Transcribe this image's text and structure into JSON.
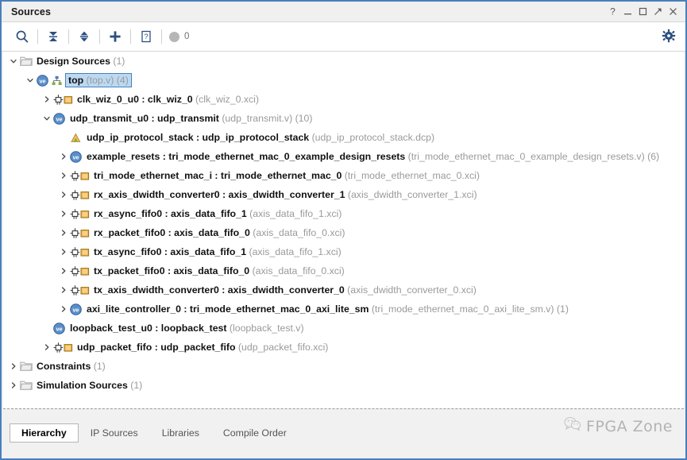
{
  "window": {
    "title": "Sources",
    "buttons": [
      {
        "name": "help-button",
        "glyph": "?"
      },
      {
        "name": "minimize-button",
        "glyph": "_"
      },
      {
        "name": "maximize-button",
        "glyph": "□"
      },
      {
        "name": "float-button",
        "glyph": "↗"
      },
      {
        "name": "close-button",
        "glyph": "✕"
      }
    ]
  },
  "toolbar": {
    "search_label": "search-icon",
    "collapse_all_label": "collapse-all-icon",
    "expand_all_label": "expand-collapse-icon",
    "add_sources_label": "add-sources-icon",
    "help_label": "help-file-icon",
    "count": "0",
    "settings_label": "settings-gear-icon"
  },
  "tree": [
    {
      "indent": 0,
      "arrow": "down",
      "icon": "folder",
      "name": "Design Sources",
      "suffix": " (1)",
      "selected": false
    },
    {
      "indent": 1,
      "arrow": "down",
      "icon": "verilog-hier",
      "name": "top",
      "suffix": " (top.v) (4)",
      "selected": true
    },
    {
      "indent": 2,
      "arrow": "right",
      "icon": "ip",
      "name": "clk_wiz_0_u0 : clk_wiz_0",
      "suffix": " (clk_wiz_0.xci)",
      "selected": false
    },
    {
      "indent": 2,
      "arrow": "down",
      "icon": "verilog",
      "name": "udp_transmit_u0 : udp_transmit",
      "suffix": " (udp_transmit.v) (10)",
      "selected": false
    },
    {
      "indent": 3,
      "arrow": "none",
      "icon": "dcp",
      "name": "udp_ip_protocol_stack : udp_ip_protocol_stack",
      "suffix": " (udp_ip_protocol_stack.dcp)",
      "selected": false
    },
    {
      "indent": 3,
      "arrow": "right",
      "icon": "verilog",
      "name": "example_resets : tri_mode_ethernet_mac_0_example_design_resets",
      "suffix": " (tri_mode_ethernet_mac_0_example_design_resets.v) (6)",
      "selected": false
    },
    {
      "indent": 3,
      "arrow": "right",
      "icon": "ip",
      "name": "tri_mode_ethernet_mac_i : tri_mode_ethernet_mac_0",
      "suffix": " (tri_mode_ethernet_mac_0.xci)",
      "selected": false
    },
    {
      "indent": 3,
      "arrow": "right",
      "icon": "ip",
      "name": "rx_axis_dwidth_converter0 : axis_dwidth_converter_1",
      "suffix": " (axis_dwidth_converter_1.xci)",
      "selected": false
    },
    {
      "indent": 3,
      "arrow": "right",
      "icon": "ip",
      "name": "rx_async_fifo0 : axis_data_fifo_1",
      "suffix": " (axis_data_fifo_1.xci)",
      "selected": false
    },
    {
      "indent": 3,
      "arrow": "right",
      "icon": "ip",
      "name": "rx_packet_fifo0 : axis_data_fifo_0",
      "suffix": " (axis_data_fifo_0.xci)",
      "selected": false
    },
    {
      "indent": 3,
      "arrow": "right",
      "icon": "ip",
      "name": "tx_async_fifo0 : axis_data_fifo_1",
      "suffix": " (axis_data_fifo_1.xci)",
      "selected": false
    },
    {
      "indent": 3,
      "arrow": "right",
      "icon": "ip",
      "name": "tx_packet_fifo0 : axis_data_fifo_0",
      "suffix": " (axis_data_fifo_0.xci)",
      "selected": false
    },
    {
      "indent": 3,
      "arrow": "right",
      "icon": "ip",
      "name": "tx_axis_dwidth_converter0 : axis_dwidth_converter_0",
      "suffix": " (axis_dwidth_converter_0.xci)",
      "selected": false
    },
    {
      "indent": 3,
      "arrow": "right",
      "icon": "verilog",
      "name": "axi_lite_controller_0 : tri_mode_ethernet_mac_0_axi_lite_sm",
      "suffix": " (tri_mode_ethernet_mac_0_axi_lite_sm.v) (1)",
      "selected": false
    },
    {
      "indent": 2,
      "arrow": "none",
      "icon": "verilog",
      "name": "loopback_test_u0 : loopback_test",
      "suffix": " (loopback_test.v)",
      "selected": false
    },
    {
      "indent": 2,
      "arrow": "right",
      "icon": "ip",
      "name": "udp_packet_fifo : udp_packet_fifo",
      "suffix": " (udp_packet_fifo.xci)",
      "selected": false
    },
    {
      "indent": 0,
      "arrow": "right",
      "icon": "folder",
      "name": "Constraints",
      "suffix": " (1)",
      "selected": false
    },
    {
      "indent": 0,
      "arrow": "right",
      "icon": "folder",
      "name": "Simulation Sources",
      "suffix": " (1)",
      "selected": false
    }
  ],
  "tabs": [
    {
      "label": "Hierarchy",
      "active": true
    },
    {
      "label": "IP Sources",
      "active": false
    },
    {
      "label": "Libraries",
      "active": false
    },
    {
      "label": "Compile Order",
      "active": false
    }
  ],
  "watermark": {
    "text": "FPGA Zone",
    "icon": "wechat-icon"
  },
  "colors": {
    "accent": "#4a7ebb",
    "selection_bg": "#bcd9f2",
    "dim_text": "#9a9a9a",
    "icon_blue": "#3f6fa8",
    "ip_orange": "#f0b341"
  }
}
